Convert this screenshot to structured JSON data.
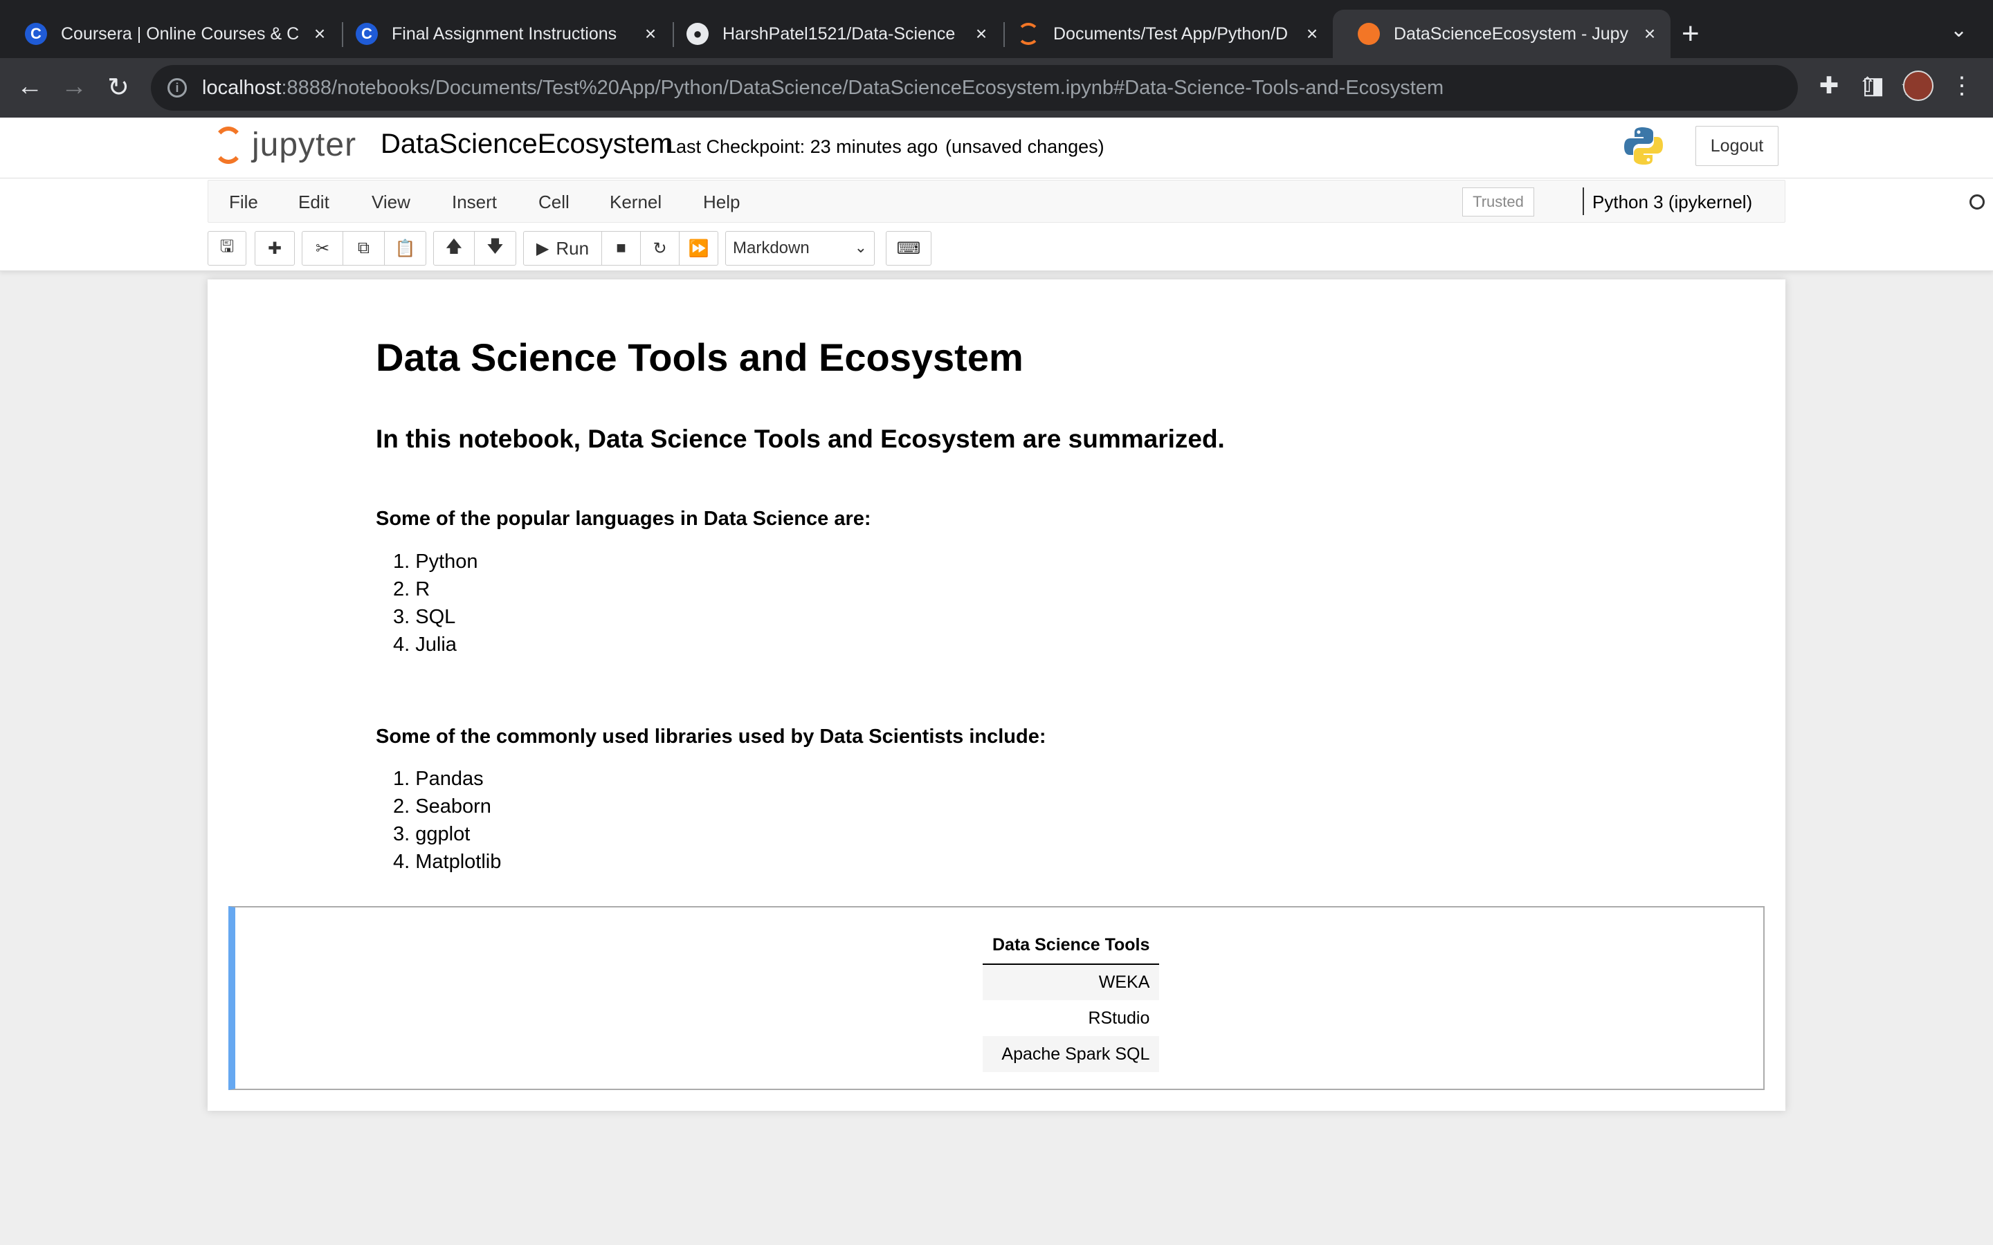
{
  "browser": {
    "tabs": [
      {
        "title": "Coursera | Online Courses & C",
        "icon": "coursera-icon"
      },
      {
        "title": "Final Assignment Instructions",
        "icon": "coursera-icon"
      },
      {
        "title": "HarshPatel1521/Data-Science",
        "icon": "github-icon"
      },
      {
        "title": "Documents/Test App/Python/D",
        "icon": "jupyter-icon"
      },
      {
        "title": "DataScienceEcosystem - Jupy",
        "icon": "notebook-icon",
        "active": true
      }
    ],
    "url_host": "localhost",
    "url_rest": ":8888/notebooks/Documents/Test%20App/Python/DataScience/DataScienceEcosystem.ipynb#Data-Science-Tools-and-Ecosystem"
  },
  "jupyter": {
    "logo_text": "jupyter",
    "notebook_name": "DataScienceEcosystem",
    "checkpoint": "Last Checkpoint: 23 minutes ago",
    "unsaved": "(unsaved changes)",
    "logout": "Logout",
    "menu": [
      "File",
      "Edit",
      "View",
      "Insert",
      "Cell",
      "Kernel",
      "Help"
    ],
    "trusted": "Trusted",
    "kernel": "Python 3 (ipykernel)",
    "run_label": "Run",
    "cell_type": "Markdown"
  },
  "content": {
    "title": "Data Science Tools and Ecosystem",
    "intro": "In this notebook, Data Science Tools and Ecosystem are summarized.",
    "languages_heading": "Some of the popular languages in Data Science are:",
    "languages": [
      "1. Python",
      "2. R",
      "3. SQL",
      "4. Julia"
    ],
    "libraries_heading": "Some of the commonly used libraries used by Data Scientists include:",
    "libraries": [
      "1. Pandas",
      "2. Seaborn",
      "3. ggplot",
      "4. Matplotlib"
    ],
    "table_header": "Data Science Tools",
    "table_rows": [
      "WEKA",
      "RStudio",
      "Apache Spark SQL"
    ]
  },
  "colors": {
    "accent": "#f37626",
    "selected_cell": "#66a8f1"
  }
}
